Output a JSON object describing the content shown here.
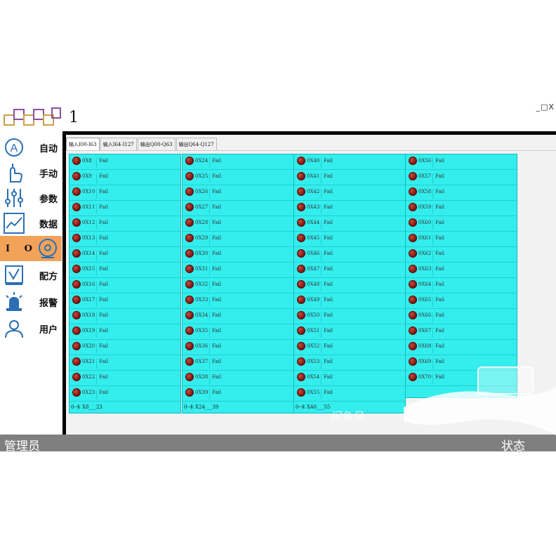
{
  "window": {
    "title": "1",
    "controls": "_□X"
  },
  "sidebar": {
    "items": [
      {
        "label": "自动",
        "icon": "auto-a-icon"
      },
      {
        "label": "手动",
        "icon": "hand-pointer-icon"
      },
      {
        "label": "参数",
        "icon": "sliders-icon"
      },
      {
        "label": "数据",
        "icon": "line-chart-icon"
      },
      {
        "label": "I O",
        "icon": "target-icon",
        "active": true
      },
      {
        "label": "配方",
        "icon": "checklist-icon"
      },
      {
        "label": "报警",
        "icon": "alarm-light-icon"
      },
      {
        "label": "用户",
        "icon": "user-icon"
      }
    ]
  },
  "tabs": [
    {
      "label": "输入I00-I63",
      "active": true
    },
    {
      "label": "输入I64-I127",
      "active": false
    },
    {
      "label": "输出Q00-Q63",
      "active": false
    },
    {
      "label": "输出Q64-Q127",
      "active": false
    }
  ],
  "columns": [
    {
      "footer": "0-卡 X8___23",
      "rows": [
        {
          "name": "0X8",
          "status": "Fail"
        },
        {
          "name": "0X9",
          "status": "Fail"
        },
        {
          "name": "0X10",
          "status": "Fail"
        },
        {
          "name": "0X11",
          "status": "Fail"
        },
        {
          "name": "0X12",
          "status": "Fail"
        },
        {
          "name": "0X13",
          "status": "Fail"
        },
        {
          "name": "0X14",
          "status": "Fail"
        },
        {
          "name": "0X15",
          "status": "Fail"
        },
        {
          "name": "0X16",
          "status": "Fail"
        },
        {
          "name": "0X17",
          "status": "Fail"
        },
        {
          "name": "0X18",
          "status": "Fail"
        },
        {
          "name": "0X19",
          "status": "Fail"
        },
        {
          "name": "0X20",
          "status": "Fail"
        },
        {
          "name": "0X21",
          "status": "Fail"
        },
        {
          "name": "0X22",
          "status": "Fail"
        },
        {
          "name": "0X23",
          "status": "Fail"
        }
      ]
    },
    {
      "footer": "0-卡 X24___39",
      "rows": [
        {
          "name": "0X24",
          "status": "Fail"
        },
        {
          "name": "0X25",
          "status": "Fail"
        },
        {
          "name": "0X26",
          "status": "Fail"
        },
        {
          "name": "0X27",
          "status": "Fail"
        },
        {
          "name": "0X28",
          "status": "Fail"
        },
        {
          "name": "0X29",
          "status": "Fail"
        },
        {
          "name": "0X30",
          "status": "Fail"
        },
        {
          "name": "0X31",
          "status": "Fail"
        },
        {
          "name": "0X32",
          "status": "Fail"
        },
        {
          "name": "0X33",
          "status": "Fail"
        },
        {
          "name": "0X34",
          "status": "Fail"
        },
        {
          "name": "0X35",
          "status": "Fail"
        },
        {
          "name": "0X36",
          "status": "Fail"
        },
        {
          "name": "0X37",
          "status": "Fail"
        },
        {
          "name": "0X38",
          "status": "Fail"
        },
        {
          "name": "0X39",
          "status": "Fail"
        }
      ]
    },
    {
      "footer": "0-卡 X40___55",
      "rows": [
        {
          "name": "0X40",
          "status": "Fail"
        },
        {
          "name": "0X41",
          "status": "Fail"
        },
        {
          "name": "0X42",
          "status": "Fail"
        },
        {
          "name": "0X43",
          "status": "Fail"
        },
        {
          "name": "0X44",
          "status": "Fail"
        },
        {
          "name": "0X45",
          "status": "Fail"
        },
        {
          "name": "0X46",
          "status": "Fail"
        },
        {
          "name": "0X47",
          "status": "Fail"
        },
        {
          "name": "0X48",
          "status": "Fail"
        },
        {
          "name": "0X49",
          "status": "Fail"
        },
        {
          "name": "0X50",
          "status": "Fail"
        },
        {
          "name": "0X51",
          "status": "Fail"
        },
        {
          "name": "0X52",
          "status": "Fail"
        },
        {
          "name": "0X53",
          "status": "Fail"
        },
        {
          "name": "0X54",
          "status": "Fail"
        },
        {
          "name": "0X55",
          "status": "Fail"
        }
      ]
    },
    {
      "footer": "",
      "rows": [
        {
          "name": "0X56",
          "status": "Fail"
        },
        {
          "name": "0X57",
          "status": "Fail"
        },
        {
          "name": "0X58",
          "status": "Fail"
        },
        {
          "name": "0X59",
          "status": "Fail"
        },
        {
          "name": "0X60",
          "status": "Fail"
        },
        {
          "name": "0X61",
          "status": "Fail"
        },
        {
          "name": "0X62",
          "status": "Fail"
        },
        {
          "name": "0X63",
          "status": "Fail"
        },
        {
          "name": "0X64",
          "status": "Fail"
        },
        {
          "name": "0X65",
          "status": "Fail"
        },
        {
          "name": "0X66",
          "status": "Fail"
        },
        {
          "name": "0X67",
          "status": "Fail"
        },
        {
          "name": "0X68",
          "status": "Fail"
        },
        {
          "name": "0X69",
          "status": "Fail"
        },
        {
          "name": "0X70",
          "status": "Fail"
        }
      ]
    }
  ],
  "statusbar": {
    "user": "管理员",
    "status": "状态"
  },
  "watermark": {
    "text": "闲鱼号"
  },
  "colors": {
    "panel_cyan": "#34eded",
    "active_nav": "#f3a25a",
    "status_bar": "#7f7f7f",
    "led_red": "#8a1a12"
  }
}
